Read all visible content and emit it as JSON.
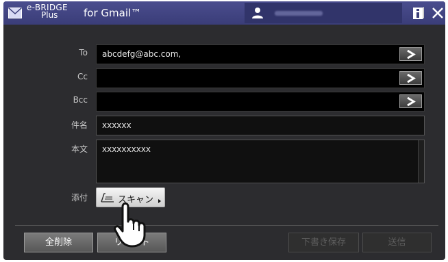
{
  "header": {
    "app_name_line1": "e-BRIDGE",
    "app_name_line2": "Plus",
    "app_subtitle": "for Gmail™",
    "icons": [
      "mail-icon",
      "user-icon",
      "info-icon",
      "close-icon"
    ]
  },
  "form": {
    "to": {
      "label": "To",
      "value": "abcdefg@abc.com,"
    },
    "cc": {
      "label": "Cc",
      "value": ""
    },
    "bcc": {
      "label": "Bcc",
      "value": ""
    },
    "subject": {
      "label": "件名",
      "value": "xxxxxx"
    },
    "body": {
      "label": "本文",
      "value": "xxxxxxxxxx"
    },
    "attachment": {
      "label": "添付",
      "scan_button": "スキャン"
    }
  },
  "footer": {
    "clear_all": "全削除",
    "reset": "リセット",
    "save_draft": "下書き保存",
    "send": "送信"
  },
  "colors": {
    "titlebar": "#3c3f7c",
    "background": "#2c2c2f",
    "field": "#000000"
  }
}
